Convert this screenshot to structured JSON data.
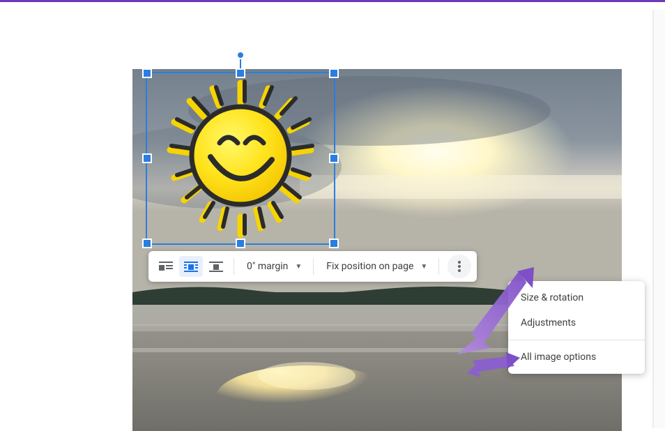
{
  "toolbar": {
    "wrap_inline_label": "In line",
    "wrap_wrap_label": "Wrap text",
    "wrap_break_label": "Break text",
    "margin": {
      "label": "0\" margin"
    },
    "position": {
      "label": "Fix position on page"
    },
    "more_label": "More options"
  },
  "menu": {
    "size_rotation": "Size & rotation",
    "adjustments": "Adjustments",
    "all_image_options": "All image options"
  }
}
